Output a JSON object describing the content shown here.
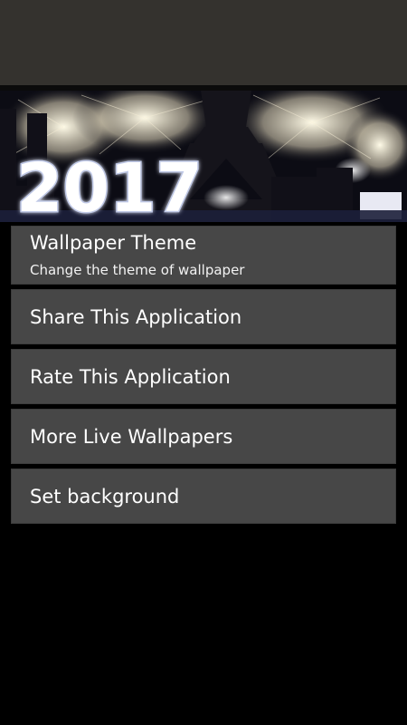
{
  "banner": {
    "year_text": "2017",
    "colors": {
      "sky": "#0c0c14",
      "fireworks": "#f7f0d8",
      "tower": "#1b1a22",
      "text_fill": "#ffffff",
      "text_glow": "#bfc8e6"
    }
  },
  "menu": {
    "items": [
      {
        "title": "Wallpaper Theme",
        "summary": "Change the theme of wallpaper"
      },
      {
        "title": "Share This Application"
      },
      {
        "title": "Rate This Application"
      },
      {
        "title": "More Live Wallpapers"
      },
      {
        "title": "Set background"
      }
    ]
  },
  "colors": {
    "top_bar": "#34322e",
    "background": "#000000",
    "item_bg": "#474747",
    "item_text": "#ffffff"
  }
}
